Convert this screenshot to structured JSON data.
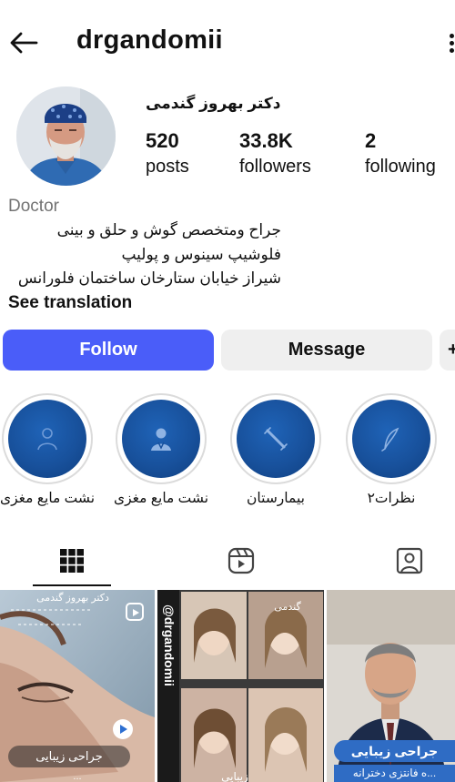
{
  "header": {
    "username": "drgandomii"
  },
  "profile": {
    "full_name": "دکتر بهروز گندمی",
    "stats": [
      {
        "value": "520",
        "label": "posts"
      },
      {
        "value": "33.8K",
        "label": "followers"
      },
      {
        "value": "2",
        "label": "following"
      }
    ],
    "category": "Doctor",
    "bio_lines": [
      "جراح ومتخصص گوش و حلق و بینی",
      "فلوشیپ سینوس و پولیپ",
      "شیراز خیابان ستارخان ساختمان فلورانس"
    ],
    "see_translation": "See translation"
  },
  "actions": {
    "follow": "Follow",
    "message": "Message",
    "suggest": "+"
  },
  "highlights": [
    {
      "label": "نشت مایع مغزی",
      "icon": "patient-icon"
    },
    {
      "label": "نشت مایع مغزی",
      "icon": "doctor-icon"
    },
    {
      "label": "بیمارستان",
      "icon": "syringe-icon"
    },
    {
      "label": "نظرات۲",
      "icon": "quill-icon"
    }
  ],
  "tabs": [
    {
      "name": "posts-grid",
      "icon": "grid-icon",
      "active": true
    },
    {
      "name": "reels",
      "icon": "reels-icon",
      "active": false
    },
    {
      "name": "tagged",
      "icon": "tagged-person-icon",
      "active": false
    }
  ],
  "posts": [
    {
      "top_text": "دکتر بهروز گندمی",
      "caption": "جراحی زیبایی",
      "sub_caption": "...",
      "badge": "reel-icon",
      "media": "play-icon"
    },
    {
      "handle": "@drgandomii",
      "top_text": "گندمی",
      "caption": "زیبایی"
    },
    {
      "caption": "جراحی زیبایی",
      "sub_caption": "...ه فانتزی دخترانه"
    }
  ],
  "colors": {
    "accent": "#4a5df9",
    "secondary_button": "#efefef",
    "highlight_cover": "#18519c",
    "muted_text": "#737373"
  }
}
